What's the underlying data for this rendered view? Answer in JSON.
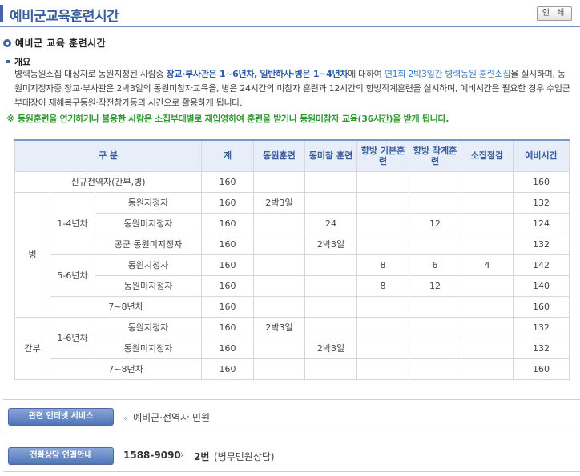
{
  "header": {
    "title": "예비군교육훈련시간",
    "print_label": "인 쇄"
  },
  "section": {
    "title": "예비군 교육 훈련시간"
  },
  "overview": {
    "title": "개요",
    "p1": "병력동원소집 대상자로 동원지정된 사람중 ",
    "p1_hl": "장교·부사관은 1~6년차, 일반하사·병은 1~4년차",
    "p2": "에 대하여 ",
    "p2_hl": "연1회 2박3일간 병력동원 훈련소집",
    "p3": "을 실시하며, 동원미지정자중 장교·부사관은 2박3일의 동원미참자교육을, 병은 24시간의 미참자 훈련과 12시간의 향방작계훈련을 실시하며, 예비시간은 필요한 경우 수임군부대장이 재해복구동원·작전참가등의 시간으로 활용하게 됩니다.",
    "notice": "※ 동원훈련을 연기하거나 불응한 사람은 소집부대별로 재입영하여 훈련을 받거나 동원미참자 교육(36시간)을 받게 됩니다."
  },
  "table": {
    "headers": [
      "구 분",
      "계",
      "동원훈련",
      "동미참 훈련",
      "향방 기본훈련",
      "향방 작계훈련",
      "소집점검",
      "예비시간"
    ],
    "rows": [
      {
        "g1": "신규전역자(간부,병)",
        "total": "160",
        "mob": "",
        "nonatt": "",
        "basic": "",
        "op": "",
        "check": "",
        "reserve": "160"
      },
      {
        "g1": "병",
        "g2": "1-4년차",
        "g3": "동원지정자",
        "total": "160",
        "mob": "2박3일",
        "nonatt": "",
        "basic": "",
        "op": "",
        "check": "",
        "reserve": "132"
      },
      {
        "g3": "동원미지정자",
        "total": "160",
        "mob": "",
        "nonatt": "24",
        "basic": "",
        "op": "12",
        "check": "",
        "reserve": "124"
      },
      {
        "g3": "공군 동원미지정자",
        "total": "160",
        "mob": "",
        "nonatt": "2박3일",
        "basic": "",
        "op": "",
        "check": "",
        "reserve": "132"
      },
      {
        "g2": "5-6년차",
        "g3": "동원지정자",
        "total": "160",
        "mob": "",
        "nonatt": "",
        "basic": "8",
        "op": "6",
        "check": "4",
        "reserve": "142"
      },
      {
        "g3": "동원미지정자",
        "total": "160",
        "mob": "",
        "nonatt": "",
        "basic": "8",
        "op": "12",
        "check": "",
        "reserve": "140"
      },
      {
        "g2": "7~8년차",
        "total": "160",
        "mob": "",
        "nonatt": "",
        "basic": "",
        "op": "",
        "check": "",
        "reserve": "160"
      },
      {
        "g1": "간부",
        "g2": "1-6년차",
        "g3": "동원지정자",
        "total": "160",
        "mob": "2박3일",
        "nonatt": "",
        "basic": "",
        "op": "",
        "check": "",
        "reserve": "132"
      },
      {
        "g3": "동원미지정자",
        "total": "160",
        "mob": "",
        "nonatt": "2박3일",
        "basic": "",
        "op": "",
        "check": "",
        "reserve": "132"
      },
      {
        "g2": "7~8년차",
        "total": "160",
        "mob": "",
        "nonatt": "",
        "basic": "",
        "op": "",
        "check": "",
        "reserve": "160"
      }
    ]
  },
  "related": {
    "button_label": "관련 인터넷 서비스",
    "link_label": "예비군·전역자 민원"
  },
  "phone": {
    "button_label": "전화상담 연결안내",
    "number": "1588-9090",
    "extension": "2번",
    "desc": "(병무민원상담)"
  },
  "colors": {
    "accent": "#3a5d9c",
    "notice_green": "#2e9a2e",
    "header_fill": "#e7eef9"
  },
  "icons": {
    "section": "circle-bullet-icon",
    "overview": "square-bullet-icon",
    "related": "double-arrow-icon",
    "phone": "chevron-right-icon"
  }
}
